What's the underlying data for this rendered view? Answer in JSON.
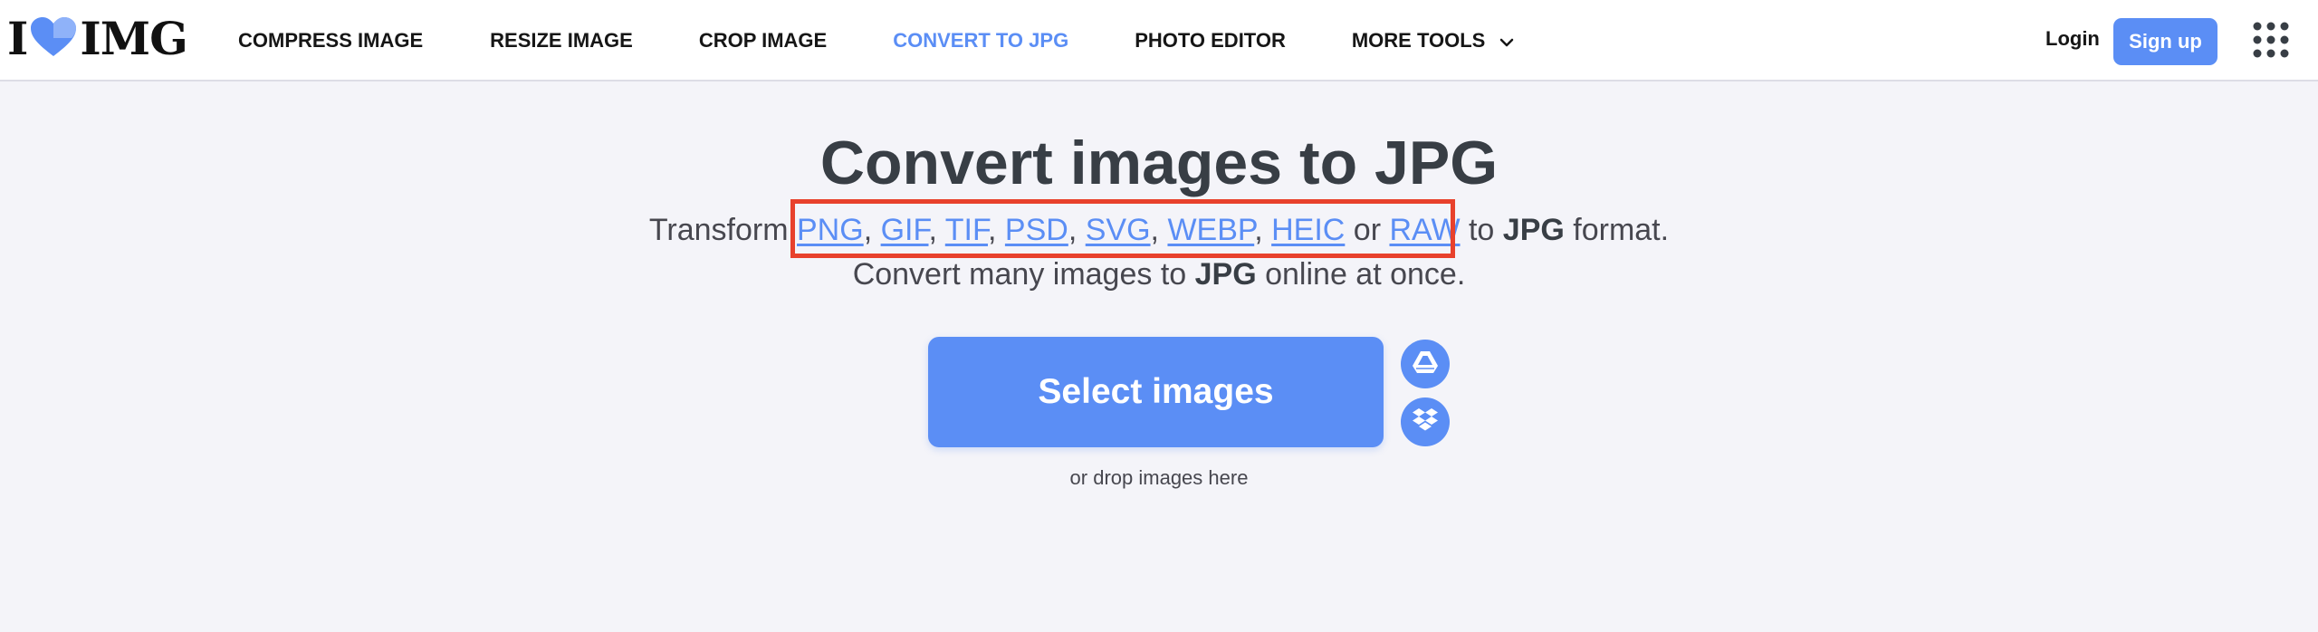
{
  "header": {
    "logo": {
      "left": "I",
      "right": "IMG"
    },
    "nav": [
      {
        "label": "COMPRESS IMAGE",
        "active": false
      },
      {
        "label": "RESIZE IMAGE",
        "active": false
      },
      {
        "label": "CROP IMAGE",
        "active": false
      },
      {
        "label": "CONVERT TO JPG",
        "active": true
      },
      {
        "label": "PHOTO EDITOR",
        "active": false
      },
      {
        "label": "MORE TOOLS",
        "active": false
      }
    ],
    "login_label": "Login",
    "signup_label": "Sign up",
    "apps_icon": "grid-icon"
  },
  "main": {
    "title": "Convert images to JPG",
    "subtitle_line1": {
      "prefix": "Transform ",
      "formats": [
        "PNG",
        "GIF",
        "TIF",
        "PSD",
        "SVG",
        "WEBP",
        "HEIC"
      ],
      "separator": ", ",
      "or_word": " or ",
      "last_format": "RAW",
      "to_word": " to ",
      "target": "JPG",
      "suffix": " format."
    },
    "subtitle_line2": {
      "prefix": "Convert many images to ",
      "target": "JPG",
      "suffix": " online at once."
    },
    "select_label": "Select images",
    "gdrive_icon": "google-drive-icon",
    "dropbox_icon": "dropbox-icon",
    "drop_text": "or drop images here"
  },
  "colors": {
    "accent": "#5b8ef5",
    "highlight": "#e8412c",
    "background": "#f4f4f9",
    "text": "#383e45"
  }
}
